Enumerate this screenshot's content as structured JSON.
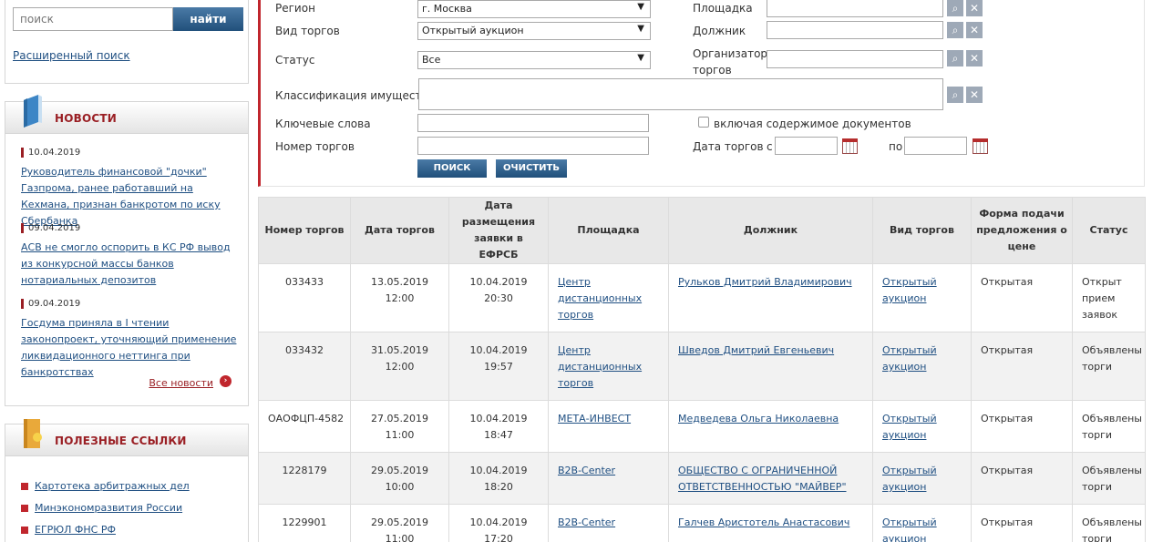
{
  "sidebar": {
    "search": {
      "placeholder": "поиск",
      "button": "найти",
      "advanced_link": "Расширенный поиск"
    },
    "news": {
      "title": "НОВОСТИ",
      "items": [
        {
          "date": "10.04.2019",
          "title": "Руководитель финансовой \"дочки\" Газпрома, ранее работавший на Кехмана, признан банкротом по иску Сбербанка"
        },
        {
          "date": "09.04.2019",
          "title": "АСВ не смогло оспорить в КС РФ вывод из конкурсной массы банков нотариальных депозитов"
        },
        {
          "date": "09.04.2019",
          "title": "Госдума приняла в I чтении законопроект, уточняющий применение ликвидационного неттинга при банкротствах"
        }
      ],
      "all_link": "Все новости"
    },
    "links": {
      "title": "ПОЛЕЗНЫЕ ССЫЛКИ",
      "items": [
        "Картотека арбитражных дел",
        "Минэкономразвития России",
        "ЕГРЮЛ ФНС РФ"
      ]
    }
  },
  "filters": {
    "region_label": "Регион",
    "region_value": "г. Москва",
    "type_label": "Вид торгов",
    "type_value": "Открытый аукцион",
    "status_label": "Статус",
    "status_value": "Все",
    "class_label": "Классификация имущества",
    "keywords_label": "Ключевые слова",
    "number_label": "Номер торгов",
    "platform_label": "Площадка",
    "debtor_label": "Должник",
    "organizer_label": "Организатор торгов",
    "include_docs_label": "включая содержимое документов",
    "date_label": "Дата торгов",
    "date_from_label": "с",
    "date_to_label": "по",
    "search_button": "ПОИСК",
    "clear_button": "ОЧИСТИТЬ"
  },
  "table": {
    "headers": [
      "Номер торгов",
      "Дата торгов",
      "Дата размещения заявки в ЕФРСБ",
      "Площадка",
      "Должник",
      "Вид торгов",
      "Форма подачи предложения о цене",
      "Статус"
    ],
    "rows": [
      {
        "number": "033433",
        "date": "13.05.2019 12:00",
        "posted": "10.04.2019 20:30",
        "platform": "Центр дистанционных торгов",
        "debtor": "Рульков Дмитрий Владимирович",
        "type": "Открытый аукцион",
        "form": "Открытая",
        "status": "Открыт прием заявок"
      },
      {
        "number": "033432",
        "date": "31.05.2019 12:00",
        "posted": "10.04.2019 19:57",
        "platform": "Центр дистанционных торгов",
        "debtor": "Шведов Дмитрий Евгеньевич",
        "type": "Открытый аукцион",
        "form": "Открытая",
        "status": "Объявлены торги"
      },
      {
        "number": "ОАОФЦП-4582",
        "date": "27.05.2019 11:00",
        "posted": "10.04.2019 18:47",
        "platform": "МЕТА-ИНВЕСТ",
        "debtor": "Медведева Ольга Николаевна",
        "type": "Открытый аукцион",
        "form": "Открытая",
        "status": "Объявлены торги"
      },
      {
        "number": "1228179",
        "date": "29.05.2019 10:00",
        "posted": "10.04.2019 18:20",
        "platform": "B2B-Center",
        "debtor": "ОБЩЕСТВО С ОГРАНИЧЕННОЙ ОТВЕТСТВЕННОСТЬЮ \"МАЙВЕР\"",
        "type": "Открытый аукцион",
        "form": "Открытая",
        "status": "Объявлены торги"
      },
      {
        "number": "1229901",
        "date": "29.05.2019 11:00",
        "posted": "10.04.2019 17:20",
        "platform": "B2B-Center",
        "debtor": "Галчев Аристотель Анастасович",
        "type": "Открытый аукцион",
        "form": "Открытая",
        "status": "Объявлены торги"
      }
    ]
  },
  "colors": {
    "accent_red": "#c0262d",
    "link_blue": "#1f4f82",
    "button_blue": "#2f5f8b"
  }
}
